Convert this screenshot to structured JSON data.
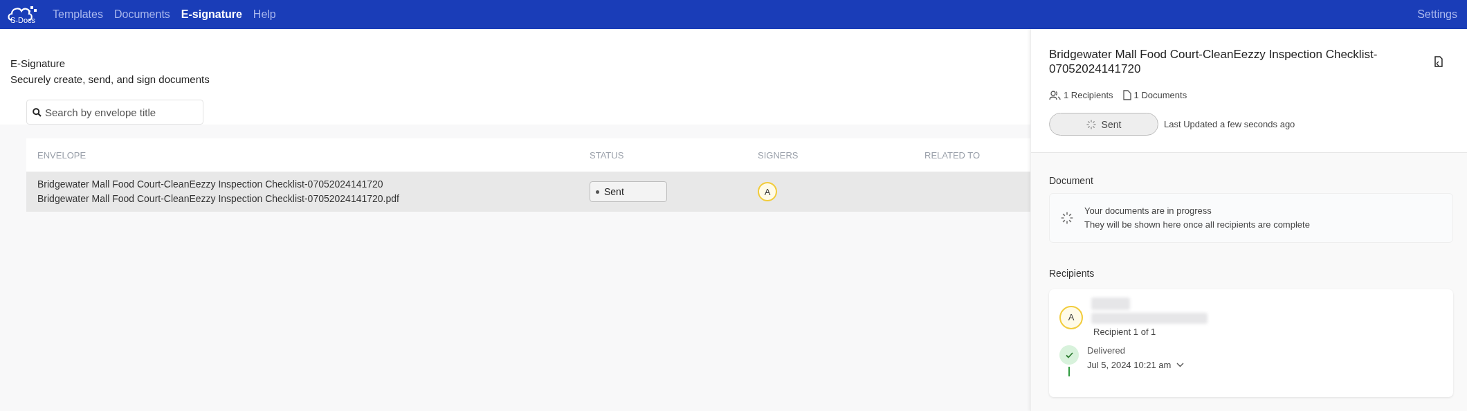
{
  "nav": {
    "logo": "S-Docs",
    "items": [
      {
        "label": "Templates",
        "selected": false
      },
      {
        "label": "Documents",
        "selected": false
      },
      {
        "label": "E-signature",
        "selected": true
      },
      {
        "label": "Help",
        "selected": false
      }
    ],
    "settings": "Settings"
  },
  "page": {
    "title": "E-Signature",
    "subtitle": "Securely create, send, and sign documents"
  },
  "search": {
    "placeholder": "Search by envelope title"
  },
  "table": {
    "columns": [
      "ENVELOPE",
      "STATUS",
      "SIGNERS",
      "RELATED TO"
    ],
    "rows": [
      {
        "selected": true,
        "title": "Bridgewater Mall Food Court-CleanEezzy Inspection Checklist-07052024141720",
        "file": "Bridgewater Mall Food Court-CleanEezzy Inspection Checklist-07052024141720.pdf",
        "status": "Sent",
        "signers": [
          "A"
        ]
      }
    ]
  },
  "detail": {
    "title": "Bridgewater Mall Food Court-CleanEezzy Inspection Checklist-07052024141720",
    "recipients_count": "1 Recipients",
    "documents_count": "1 Documents",
    "status": "Sent",
    "updated": "Last Updated a few seconds ago",
    "document_heading": "Document",
    "progress_title": "Your documents are in progress",
    "progress_note": "They will be shown here once all recipients are complete",
    "recipients_heading": "Recipients",
    "recipients": [
      {
        "initial": "A",
        "position": "Recipient 1 of 1",
        "events": [
          {
            "label": "Delivered",
            "time": "Jul 5, 2024 10:21 am",
            "done": true
          }
        ]
      }
    ]
  }
}
